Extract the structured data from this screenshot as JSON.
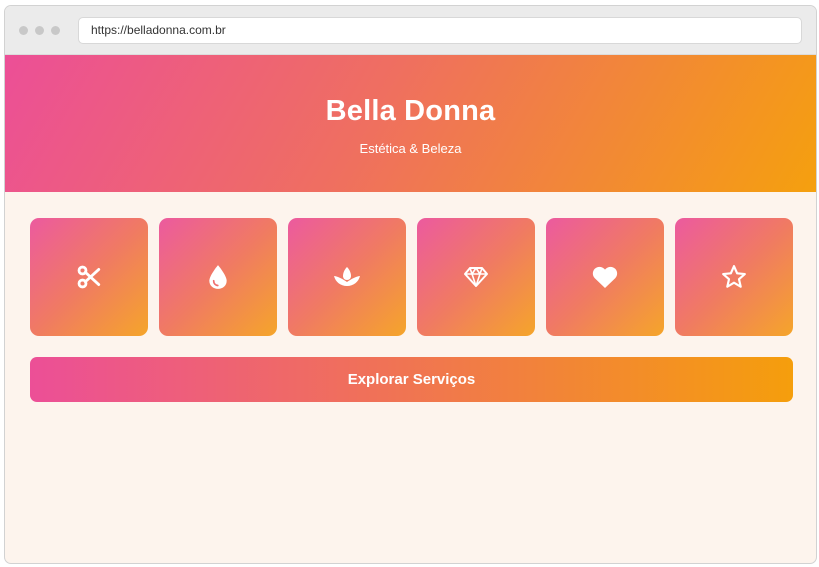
{
  "browser": {
    "url": "https://belladonna.com.br"
  },
  "hero": {
    "title": "Bella Donna",
    "subtitle": "Estética & Beleza"
  },
  "services": [
    {
      "icon": "scissors-icon"
    },
    {
      "icon": "droplet-icon"
    },
    {
      "icon": "lotus-icon"
    },
    {
      "icon": "diamond-icon"
    },
    {
      "icon": "heart-icon"
    },
    {
      "icon": "star-icon"
    }
  ],
  "cta": {
    "label": "Explorar Serviços"
  },
  "colors": {
    "gradient_start": "#ec4f97",
    "gradient_end": "#f5a00e",
    "page_background": "#fdf4ed",
    "text_on_accent": "#ffffff"
  }
}
